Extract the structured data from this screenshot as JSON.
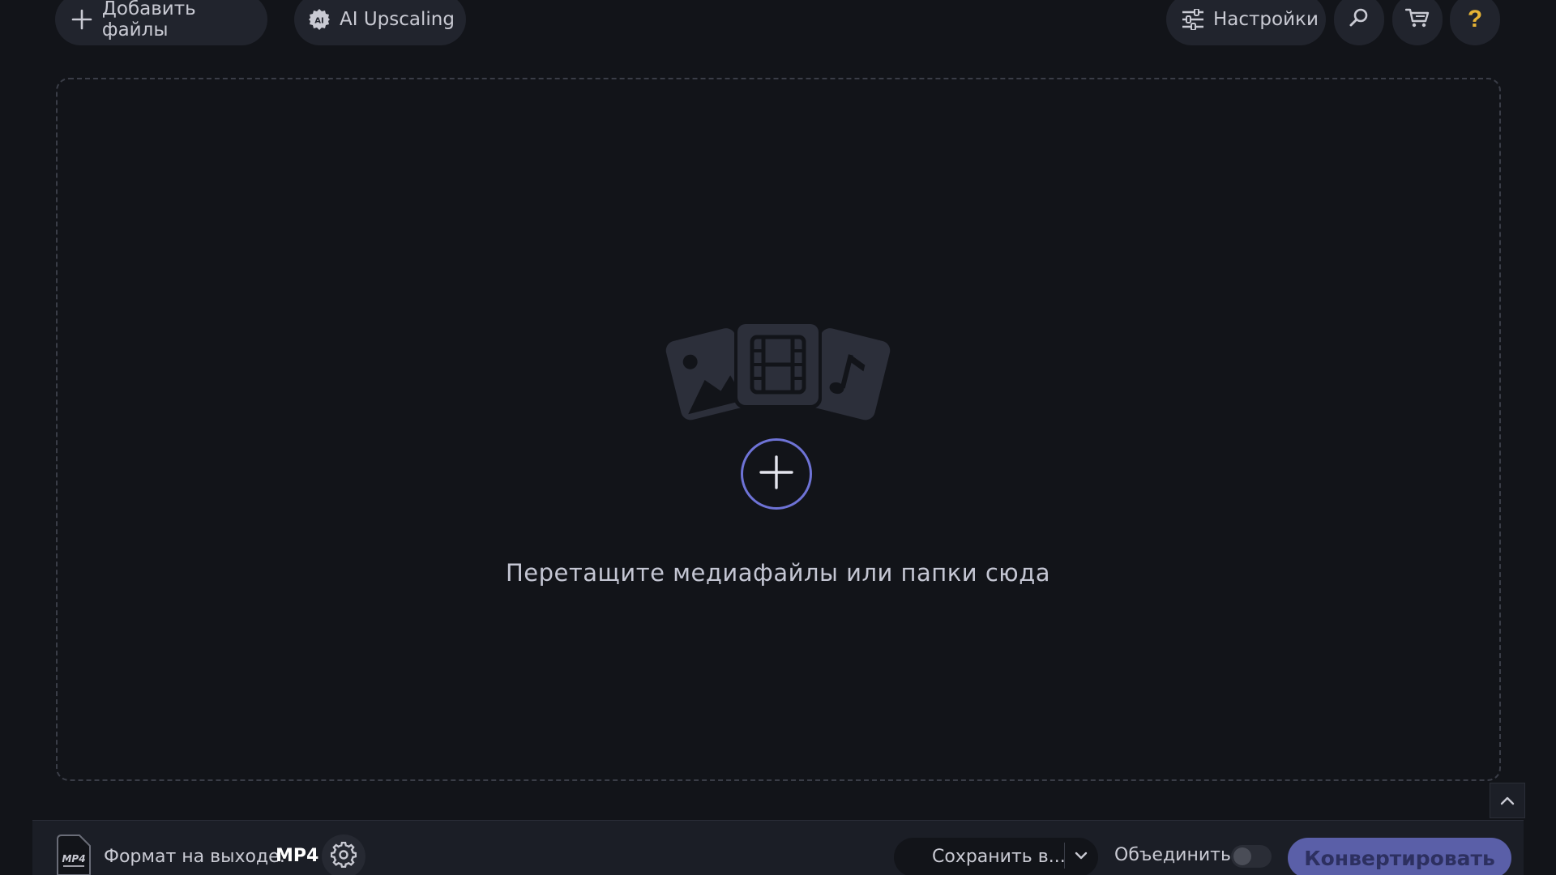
{
  "toolbar": {
    "add_files_label": "Добавить файлы",
    "ai_upscaling_label": "AI Upscaling",
    "settings_label": "Настройки",
    "help_label": "?"
  },
  "dropzone": {
    "hint": "Перетащите медиафайлы или папки сюда"
  },
  "bottom": {
    "format_icon_text": "MP4",
    "format_label": "Формат на выходе:",
    "format_value": "MP4",
    "save_label": "Сохранить в...",
    "merge_label": "Объединить:",
    "merge_enabled": false,
    "convert_label": "Конвертировать"
  },
  "colors": {
    "background": "#121419",
    "panel": "#21242d",
    "accent": "#6e73d6",
    "convert_button": "#5a5fa8",
    "help_icon": "#e6b335"
  },
  "icons": {
    "add": "plus-icon",
    "ai": "ai-chip-icon",
    "settings": "sliders-icon",
    "search": "search-icon",
    "cart": "cart-icon",
    "help": "question-icon",
    "scroll": "chevron-up-icon",
    "format_settings": "gear-icon",
    "save_dropdown": "chevron-down-icon"
  }
}
